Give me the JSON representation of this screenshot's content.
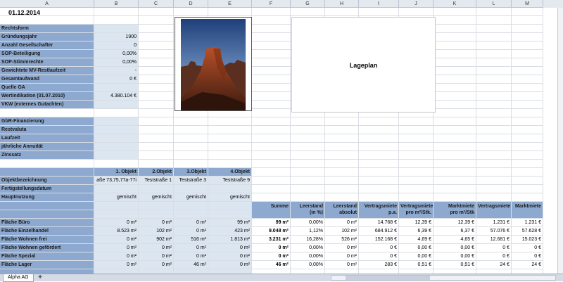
{
  "columns": [
    "A",
    "B",
    "C",
    "D",
    "E",
    "F",
    "G",
    "H",
    "I",
    "J",
    "K",
    "L",
    "M"
  ],
  "date": "01.12.2014",
  "lageplan_label": "Lageplan",
  "fund_rows": [
    {
      "label": "Rechtsform",
      "value": ""
    },
    {
      "label": "Gründungsjahr",
      "value": "1900"
    },
    {
      "label": "Anzahl Gesellschafter",
      "value": "0"
    },
    {
      "label": "SOP-Beteiligung",
      "value": "0,00%"
    },
    {
      "label": "SOP-Stimmrechte",
      "value": "0,00%"
    },
    {
      "label": "Gewichtete MV-Restlaufzeit",
      "value": "-"
    },
    {
      "label": "Gesamtaufwand",
      "value": "0 €"
    },
    {
      "label": "Quelle GA",
      "value": ""
    },
    {
      "label": "Wertindikation (01.07.2010)",
      "value": "4.380.104 €"
    },
    {
      "label": "VKW (externes Gutachten)",
      "value": ""
    }
  ],
  "financing_rows": [
    {
      "label": "GbR-Finanzierung"
    },
    {
      "label": "Restvaluta"
    },
    {
      "label": "Laufzeit"
    },
    {
      "label": "jährliche Annuität"
    },
    {
      "label": "Zinssatz"
    }
  ],
  "objects": {
    "headers": [
      "1. Objekt",
      "2.Objekt",
      "3.Objekt",
      "4.Objekt"
    ],
    "bezeichnung_label": "Objektbezeichnung",
    "bezeichnung": [
      "aße 73,75,77a-77i",
      "Teststraße 1",
      "Teststraße 3",
      "Teststraße 9"
    ],
    "fertig_label": "Fertigstellungsdatum",
    "nutzung_label": "Hauptnutzung",
    "nutzung": [
      "gemischt",
      "gemischt",
      "gemischt",
      "gemischt"
    ]
  },
  "summary_headers": [
    [
      "Summe",
      ""
    ],
    [
      "Leerstand",
      "(in %)"
    ],
    [
      "Leerstand",
      "absolut"
    ],
    [
      "Vertragsmiete",
      "p.a."
    ],
    [
      "Vertragsmiete",
      "pro m²/Stk."
    ],
    [
      "Marktmiete",
      "pro m²/Stk"
    ],
    [
      "Vertragsmiete",
      ""
    ],
    [
      "Marktmiete",
      ""
    ]
  ],
  "area_rows": [
    {
      "label": "Fläche Büro",
      "objs": [
        "0 m²",
        "0 m²",
        "0 m²",
        "99 m²"
      ],
      "sum": "99 m²",
      "vals": [
        "0,00%",
        "0 m²",
        "14.768 €",
        "12,39 €",
        "12,39 €",
        "1.231 €",
        "1.231 €"
      ]
    },
    {
      "label": "Fläche Einzelhandel",
      "objs": [
        "8.523 m²",
        "102 m²",
        "0 m²",
        "423 m²"
      ],
      "sum": "9.048 m²",
      "vals": [
        "1,12%",
        "102 m²",
        "684.912 €",
        "6,39 €",
        "6,37 €",
        "57.076 €",
        "57.628 €"
      ]
    },
    {
      "label": "Fläche Wohnen frei",
      "objs": [
        "0 m²",
        "902 m²",
        "516 m²",
        "1.813 m²"
      ],
      "sum": "3.231 m²",
      "vals": [
        "16,28%",
        "526 m²",
        "152.168 €",
        "4,69 €",
        "4,65 €",
        "12.681 €",
        "15.023 €"
      ]
    },
    {
      "label": "Fläche Wohnen gefördert",
      "objs": [
        "0 m²",
        "0 m²",
        "0 m²",
        "0 m²"
      ],
      "sum": "0 m²",
      "vals": [
        "0,00%",
        "0 m²",
        "0 €",
        "0,00 €",
        "0,00 €",
        "0 €",
        "0 €"
      ]
    },
    {
      "label": "Fläche Spezial",
      "objs": [
        "0 m²",
        "0 m²",
        "0 m²",
        "0 m²"
      ],
      "sum": "0 m²",
      "vals": [
        "0,00%",
        "0 m²",
        "0 €",
        "0,00 €",
        "0,00 €",
        "0 €",
        "0 €"
      ]
    },
    {
      "label": "Fläche Lager",
      "objs": [
        "0 m²",
        "0 m²",
        "46 m²",
        "0 m²"
      ],
      "sum": "46 m²",
      "vals": [
        "0,00%",
        "0 m²",
        "283 €",
        "0,51 €",
        "0,51 €",
        "24 €",
        "24 €"
      ]
    }
  ],
  "sheet_tab": "Alpha AG",
  "colors": {
    "label_bg": "#8ea9cf",
    "value_bg": "#dce6f1",
    "header_bg": "#e4e9f0"
  }
}
